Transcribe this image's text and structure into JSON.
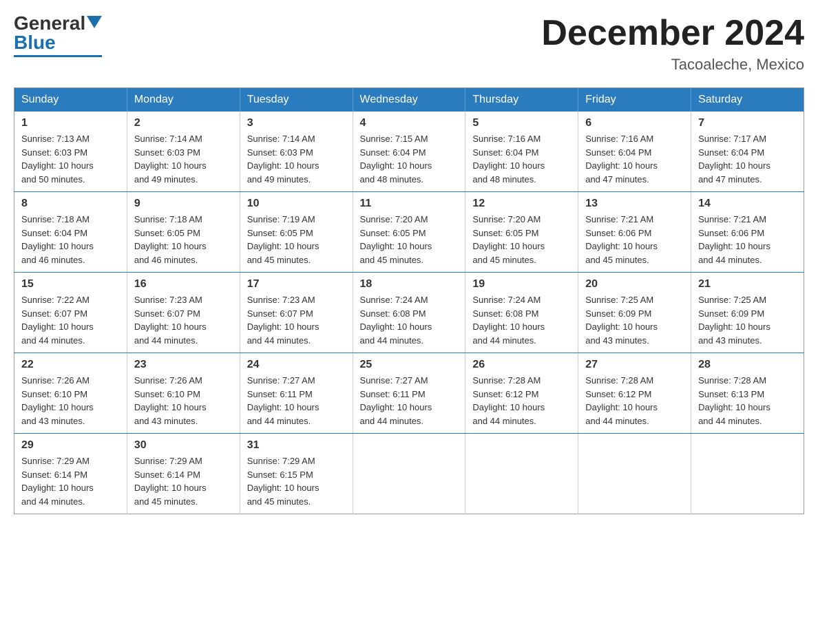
{
  "header": {
    "logo_general": "General",
    "logo_blue": "Blue",
    "month_title": "December 2024",
    "location": "Tacoaleche, Mexico"
  },
  "days_of_week": [
    "Sunday",
    "Monday",
    "Tuesday",
    "Wednesday",
    "Thursday",
    "Friday",
    "Saturday"
  ],
  "weeks": [
    [
      {
        "day": "1",
        "sunrise": "7:13 AM",
        "sunset": "6:03 PM",
        "daylight": "10 hours and 50 minutes."
      },
      {
        "day": "2",
        "sunrise": "7:14 AM",
        "sunset": "6:03 PM",
        "daylight": "10 hours and 49 minutes."
      },
      {
        "day": "3",
        "sunrise": "7:14 AM",
        "sunset": "6:03 PM",
        "daylight": "10 hours and 49 minutes."
      },
      {
        "day": "4",
        "sunrise": "7:15 AM",
        "sunset": "6:04 PM",
        "daylight": "10 hours and 48 minutes."
      },
      {
        "day": "5",
        "sunrise": "7:16 AM",
        "sunset": "6:04 PM",
        "daylight": "10 hours and 48 minutes."
      },
      {
        "day": "6",
        "sunrise": "7:16 AM",
        "sunset": "6:04 PM",
        "daylight": "10 hours and 47 minutes."
      },
      {
        "day": "7",
        "sunrise": "7:17 AM",
        "sunset": "6:04 PM",
        "daylight": "10 hours and 47 minutes."
      }
    ],
    [
      {
        "day": "8",
        "sunrise": "7:18 AM",
        "sunset": "6:04 PM",
        "daylight": "10 hours and 46 minutes."
      },
      {
        "day": "9",
        "sunrise": "7:18 AM",
        "sunset": "6:05 PM",
        "daylight": "10 hours and 46 minutes."
      },
      {
        "day": "10",
        "sunrise": "7:19 AM",
        "sunset": "6:05 PM",
        "daylight": "10 hours and 45 minutes."
      },
      {
        "day": "11",
        "sunrise": "7:20 AM",
        "sunset": "6:05 PM",
        "daylight": "10 hours and 45 minutes."
      },
      {
        "day": "12",
        "sunrise": "7:20 AM",
        "sunset": "6:05 PM",
        "daylight": "10 hours and 45 minutes."
      },
      {
        "day": "13",
        "sunrise": "7:21 AM",
        "sunset": "6:06 PM",
        "daylight": "10 hours and 45 minutes."
      },
      {
        "day": "14",
        "sunrise": "7:21 AM",
        "sunset": "6:06 PM",
        "daylight": "10 hours and 44 minutes."
      }
    ],
    [
      {
        "day": "15",
        "sunrise": "7:22 AM",
        "sunset": "6:07 PM",
        "daylight": "10 hours and 44 minutes."
      },
      {
        "day": "16",
        "sunrise": "7:23 AM",
        "sunset": "6:07 PM",
        "daylight": "10 hours and 44 minutes."
      },
      {
        "day": "17",
        "sunrise": "7:23 AM",
        "sunset": "6:07 PM",
        "daylight": "10 hours and 44 minutes."
      },
      {
        "day": "18",
        "sunrise": "7:24 AM",
        "sunset": "6:08 PM",
        "daylight": "10 hours and 44 minutes."
      },
      {
        "day": "19",
        "sunrise": "7:24 AM",
        "sunset": "6:08 PM",
        "daylight": "10 hours and 44 minutes."
      },
      {
        "day": "20",
        "sunrise": "7:25 AM",
        "sunset": "6:09 PM",
        "daylight": "10 hours and 43 minutes."
      },
      {
        "day": "21",
        "sunrise": "7:25 AM",
        "sunset": "6:09 PM",
        "daylight": "10 hours and 43 minutes."
      }
    ],
    [
      {
        "day": "22",
        "sunrise": "7:26 AM",
        "sunset": "6:10 PM",
        "daylight": "10 hours and 43 minutes."
      },
      {
        "day": "23",
        "sunrise": "7:26 AM",
        "sunset": "6:10 PM",
        "daylight": "10 hours and 43 minutes."
      },
      {
        "day": "24",
        "sunrise": "7:27 AM",
        "sunset": "6:11 PM",
        "daylight": "10 hours and 44 minutes."
      },
      {
        "day": "25",
        "sunrise": "7:27 AM",
        "sunset": "6:11 PM",
        "daylight": "10 hours and 44 minutes."
      },
      {
        "day": "26",
        "sunrise": "7:28 AM",
        "sunset": "6:12 PM",
        "daylight": "10 hours and 44 minutes."
      },
      {
        "day": "27",
        "sunrise": "7:28 AM",
        "sunset": "6:12 PM",
        "daylight": "10 hours and 44 minutes."
      },
      {
        "day": "28",
        "sunrise": "7:28 AM",
        "sunset": "6:13 PM",
        "daylight": "10 hours and 44 minutes."
      }
    ],
    [
      {
        "day": "29",
        "sunrise": "7:29 AM",
        "sunset": "6:14 PM",
        "daylight": "10 hours and 44 minutes."
      },
      {
        "day": "30",
        "sunrise": "7:29 AM",
        "sunset": "6:14 PM",
        "daylight": "10 hours and 45 minutes."
      },
      {
        "day": "31",
        "sunrise": "7:29 AM",
        "sunset": "6:15 PM",
        "daylight": "10 hours and 45 minutes."
      },
      null,
      null,
      null,
      null
    ]
  ],
  "labels": {
    "sunrise": "Sunrise:",
    "sunset": "Sunset:",
    "daylight": "Daylight:"
  }
}
